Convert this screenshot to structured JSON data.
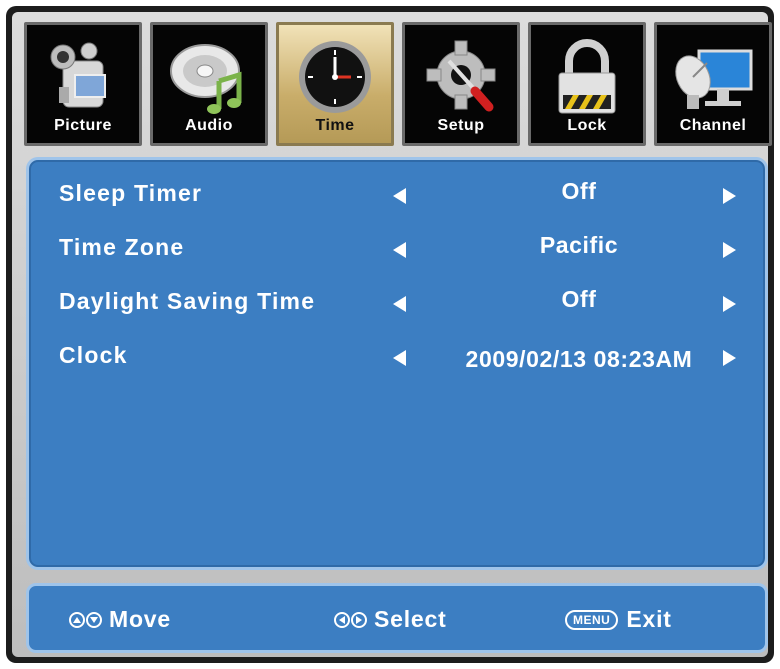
{
  "tabs": [
    {
      "label": "Picture",
      "icon": "camcorder-icon"
    },
    {
      "label": "Audio",
      "icon": "music-disc-icon"
    },
    {
      "label": "Time",
      "icon": "clock-icon",
      "active": true
    },
    {
      "label": "Setup",
      "icon": "gear-screwdriver-icon"
    },
    {
      "label": "Lock",
      "icon": "padlock-icon"
    },
    {
      "label": "Channel",
      "icon": "satellite-monitor-icon"
    }
  ],
  "settings": [
    {
      "name": "Sleep Timer",
      "value": "Off"
    },
    {
      "name": "Time Zone",
      "value": "Pacific"
    },
    {
      "name": "Daylight Saving Time",
      "value": "Off"
    },
    {
      "name": "Clock",
      "value": "2009/02/13 08:23AM"
    }
  ],
  "footer": {
    "move": "Move",
    "select": "Select",
    "menu_key": "MENU",
    "exit": "Exit"
  },
  "colors": {
    "panel": "#3c7ec2",
    "panel_border": "#9fc4ea",
    "active_tab": "#c9ad6a",
    "tab_bg": "#050505"
  }
}
